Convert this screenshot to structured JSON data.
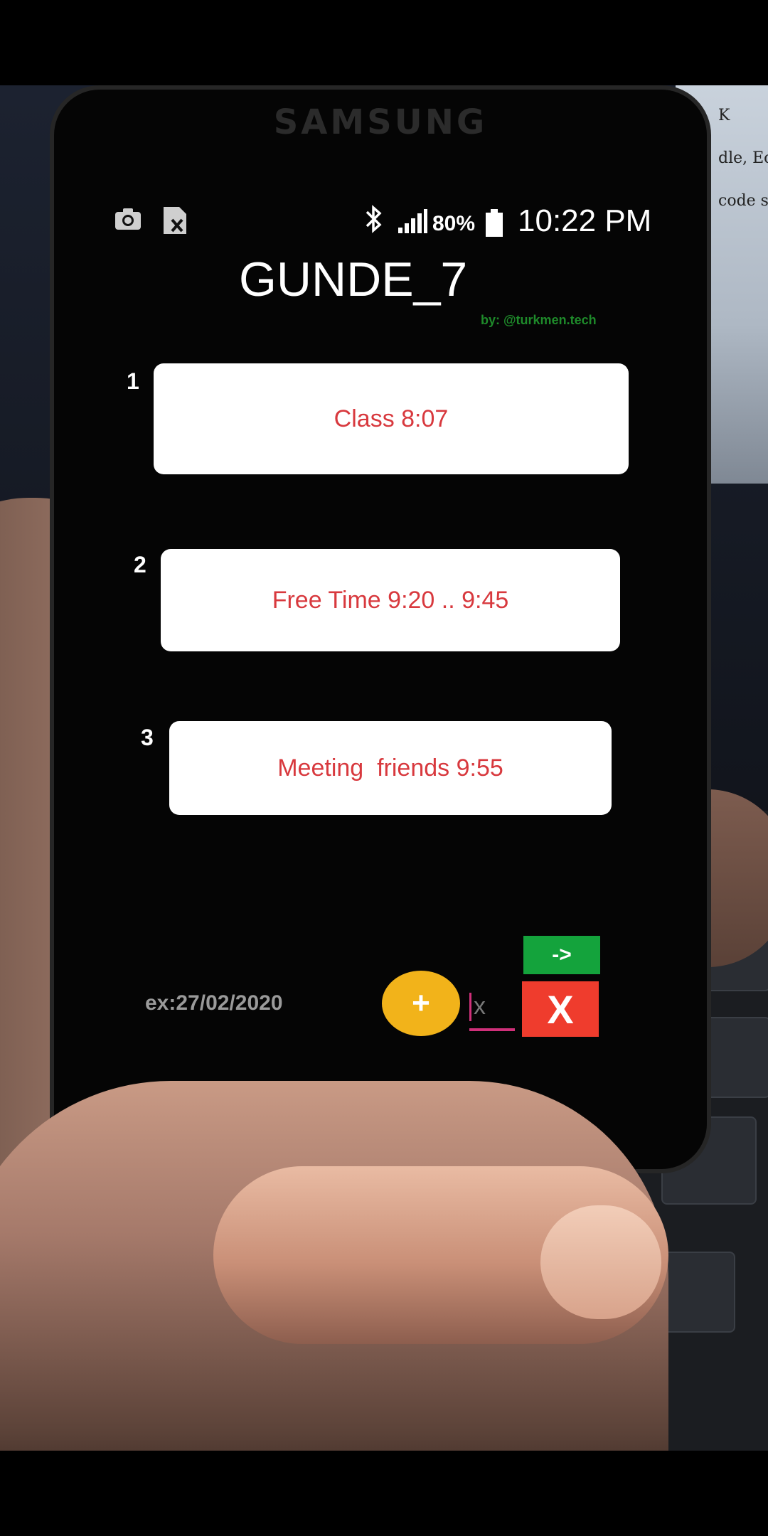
{
  "device": {
    "brand": "SAMSUNG"
  },
  "background_monitor": {
    "lines": [
      "K",
      "dle, Eclip",
      "code sa"
    ]
  },
  "status_bar": {
    "camera_icon": "camera-icon",
    "sim_icon": "sim-card-icon",
    "bluetooth_icon": "bluetooth-icon",
    "signal_icon": "signal-icon",
    "battery_percent": "80%",
    "battery_icon": "battery-icon",
    "time": "10:22 PM"
  },
  "app": {
    "title": "GUNDE_7",
    "credit": "by: @turkmen.tech"
  },
  "items": [
    {
      "number": "1",
      "text": "Class 8:07"
    },
    {
      "number": "2",
      "text": "Free Time 9:20 .. 9:45"
    },
    {
      "number": "3",
      "text": "Meeting  friends 9:55"
    }
  ],
  "controls": {
    "date_placeholder": "ex:27/02/2020",
    "add_label": "+",
    "small_input_value": "x",
    "next_label": "->",
    "close_label": "X"
  },
  "colors": {
    "card_text": "#d8393e",
    "add_button": "#f2b31a",
    "next_button": "#14a33c",
    "close_button": "#ef3c2d",
    "credit_text": "#1e8a2a"
  }
}
